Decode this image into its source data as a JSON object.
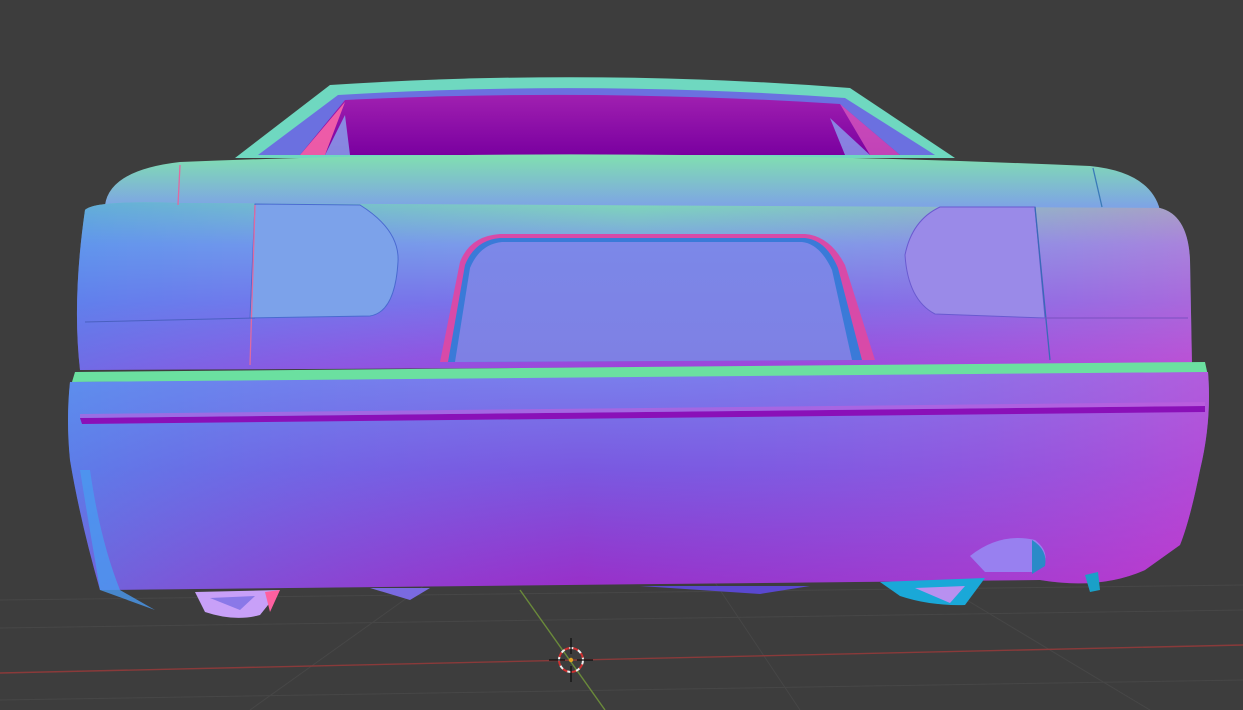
{
  "viewport": {
    "background_color": "#3d3d3d",
    "grid_line_color": "#4a4a4a",
    "x_axis_color": "#8a3a3a",
    "y_axis_color": "#6a8a3a",
    "shading_mode": "normal-map",
    "object": "car-rear-3d-model",
    "cursor_icon": "3d-cursor-icon"
  }
}
